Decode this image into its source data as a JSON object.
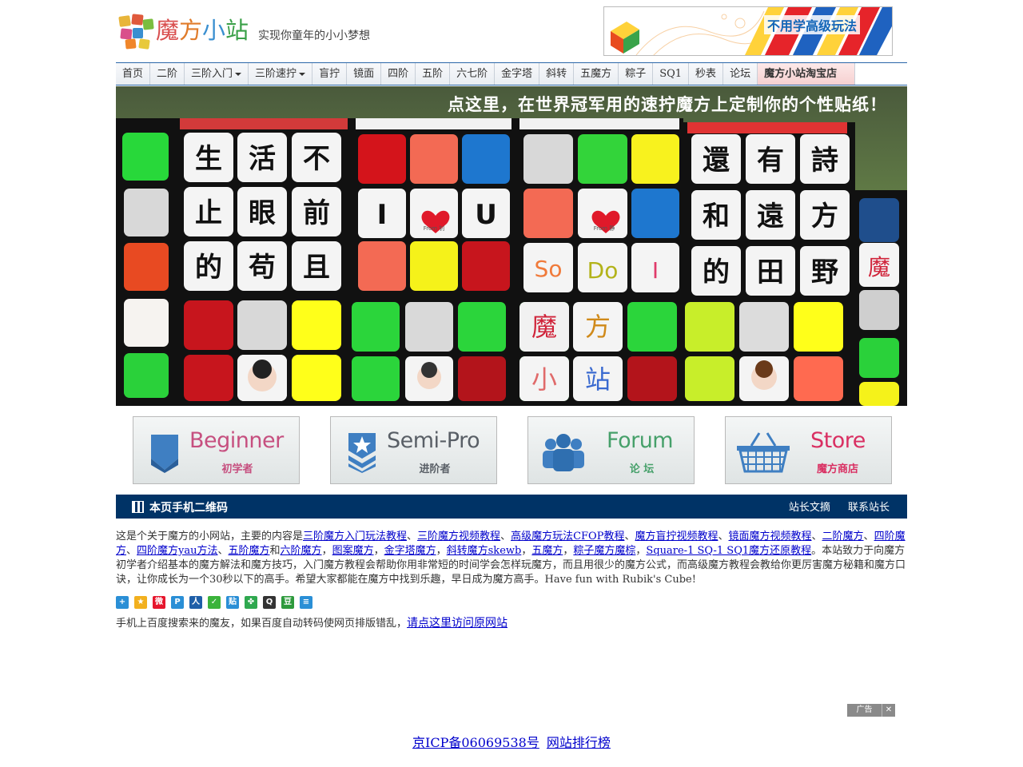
{
  "header": {
    "logo_text": [
      "魔",
      "方",
      "小",
      "站"
    ],
    "slogan": "实现你童年的小小梦想",
    "top_ad_text": "不用学高级玩法"
  },
  "nav": {
    "items": [
      {
        "label": "首页",
        "dropdown": false
      },
      {
        "label": "二阶",
        "dropdown": false
      },
      {
        "label": "三阶入门",
        "dropdown": true
      },
      {
        "label": "三阶速拧",
        "dropdown": true
      },
      {
        "label": "盲拧",
        "dropdown": false
      },
      {
        "label": "镜面",
        "dropdown": false
      },
      {
        "label": "四阶",
        "dropdown": false
      },
      {
        "label": "五阶",
        "dropdown": false
      },
      {
        "label": "六七阶",
        "dropdown": false
      },
      {
        "label": "金字塔",
        "dropdown": false
      },
      {
        "label": "斜转",
        "dropdown": false
      },
      {
        "label": "五魔方",
        "dropdown": false
      },
      {
        "label": "粽子",
        "dropdown": false
      },
      {
        "label": "SQ1",
        "dropdown": false
      },
      {
        "label": "秒表",
        "dropdown": false
      },
      {
        "label": "论坛",
        "dropdown": false
      }
    ],
    "shop_label": "魔方小站淘宝店"
  },
  "banner": {
    "headline": "点这里，在世界冠军用的速拧魔方上定制你的个性贴纸！",
    "row1": [
      "生",
      "活",
      "不",
      "還",
      "有",
      "詩"
    ],
    "row2": [
      "止",
      "眼",
      "前",
      "I",
      "U",
      "和",
      "遠",
      "方"
    ],
    "row3": [
      "的",
      "苟",
      "且",
      "So",
      "Do",
      "I",
      "的",
      "田",
      "野"
    ],
    "row4": [
      "魔",
      "方",
      "小",
      "站"
    ],
    "side_char": "魔",
    "heart_caption_1": "From 钊",
    "heart_caption_2": "From 静"
  },
  "categories": [
    {
      "en": "Beginner",
      "zh": "初学者",
      "color": "#c64f7f",
      "icon": "shield-icon"
    },
    {
      "en": "Semi-Pro",
      "zh": "进阶者",
      "color": "#595f66",
      "icon": "star-badge-icon"
    },
    {
      "en": "Forum",
      "zh": "论 坛",
      "color": "#46a06a",
      "icon": "group-icon"
    },
    {
      "en": "Store",
      "zh": "魔方商店",
      "color": "#d92f62",
      "icon": "basket-icon"
    }
  ],
  "qrbar": {
    "title": "本页手机二维码",
    "link1": "站长文摘",
    "link2": "联系站长"
  },
  "intro": {
    "prefix": "这是个关于魔方的小网站，主要的内容是",
    "links": [
      "三阶魔方入门玩法教程",
      "三阶魔方视频教程",
      "高级魔方玩法CFOP教程",
      "魔方盲拧视频教程",
      "镜面魔方视频教程",
      "二阶魔方",
      "四阶魔方",
      "四阶魔方yau方法",
      "五阶魔方",
      "六阶魔方",
      "图案魔方",
      "金字塔魔方",
      "斜转魔方skewb",
      "五魔方",
      "粽子魔方魔棕",
      "Square-1 SQ-1 SQ1魔方还原教程"
    ],
    "sep_comma_cn": "、",
    "sep_comma": "，",
    "and": "和",
    "suffix": "。本站致力于向魔方初学者介绍基本的魔方解法和魔方技巧，入门魔方教程会帮助你用非常短的时间学会怎样玩魔方，而且用很少的魔方公式，而高级魔方教程会教给你更厉害魔方秘籍和魔方口诀，让你成长为一个30秒以下的高手。希望大家都能在魔方中找到乐趣，早日成为魔方高手。Have fun with Rubik's Cube!"
  },
  "share_icons": [
    {
      "name": "share-more-icon",
      "color": "#2a8fd6",
      "glyph": "+"
    },
    {
      "name": "qzone-icon",
      "color": "#f2b01e",
      "glyph": "★"
    },
    {
      "name": "weibo-icon",
      "color": "#e6162d",
      "glyph": "微"
    },
    {
      "name": "tencent-weibo-icon",
      "color": "#2a8fd6",
      "glyph": "P"
    },
    {
      "name": "renren-icon",
      "color": "#1f5fa8",
      "glyph": "人"
    },
    {
      "name": "wechat-icon",
      "color": "#3bb33b",
      "glyph": "✓"
    },
    {
      "name": "tieba-icon",
      "color": "#2a8fd6",
      "glyph": "贴"
    },
    {
      "name": "kaixin-icon",
      "color": "#2fa84f",
      "glyph": "✤"
    },
    {
      "name": "qq-icon",
      "color": "#333333",
      "glyph": "Q"
    },
    {
      "name": "douban-icon",
      "color": "#2d9a3c",
      "glyph": "豆"
    },
    {
      "name": "print-icon",
      "color": "#2a8fd6",
      "glyph": "≡"
    }
  ],
  "mobile_note": {
    "text": "手机上百度搜索来的魔友，如果百度自动转码使网页排版错乱，",
    "link": "请点这里访问原网站"
  },
  "ad": {
    "label": "广告",
    "close": "✕"
  },
  "footer": {
    "icp": "京ICP备06069538号",
    "rank": "网站排行榜"
  },
  "colors": {
    "nav_border": "#2a66a8",
    "qrbar_bg": "#003366",
    "link": "#0000cc"
  }
}
